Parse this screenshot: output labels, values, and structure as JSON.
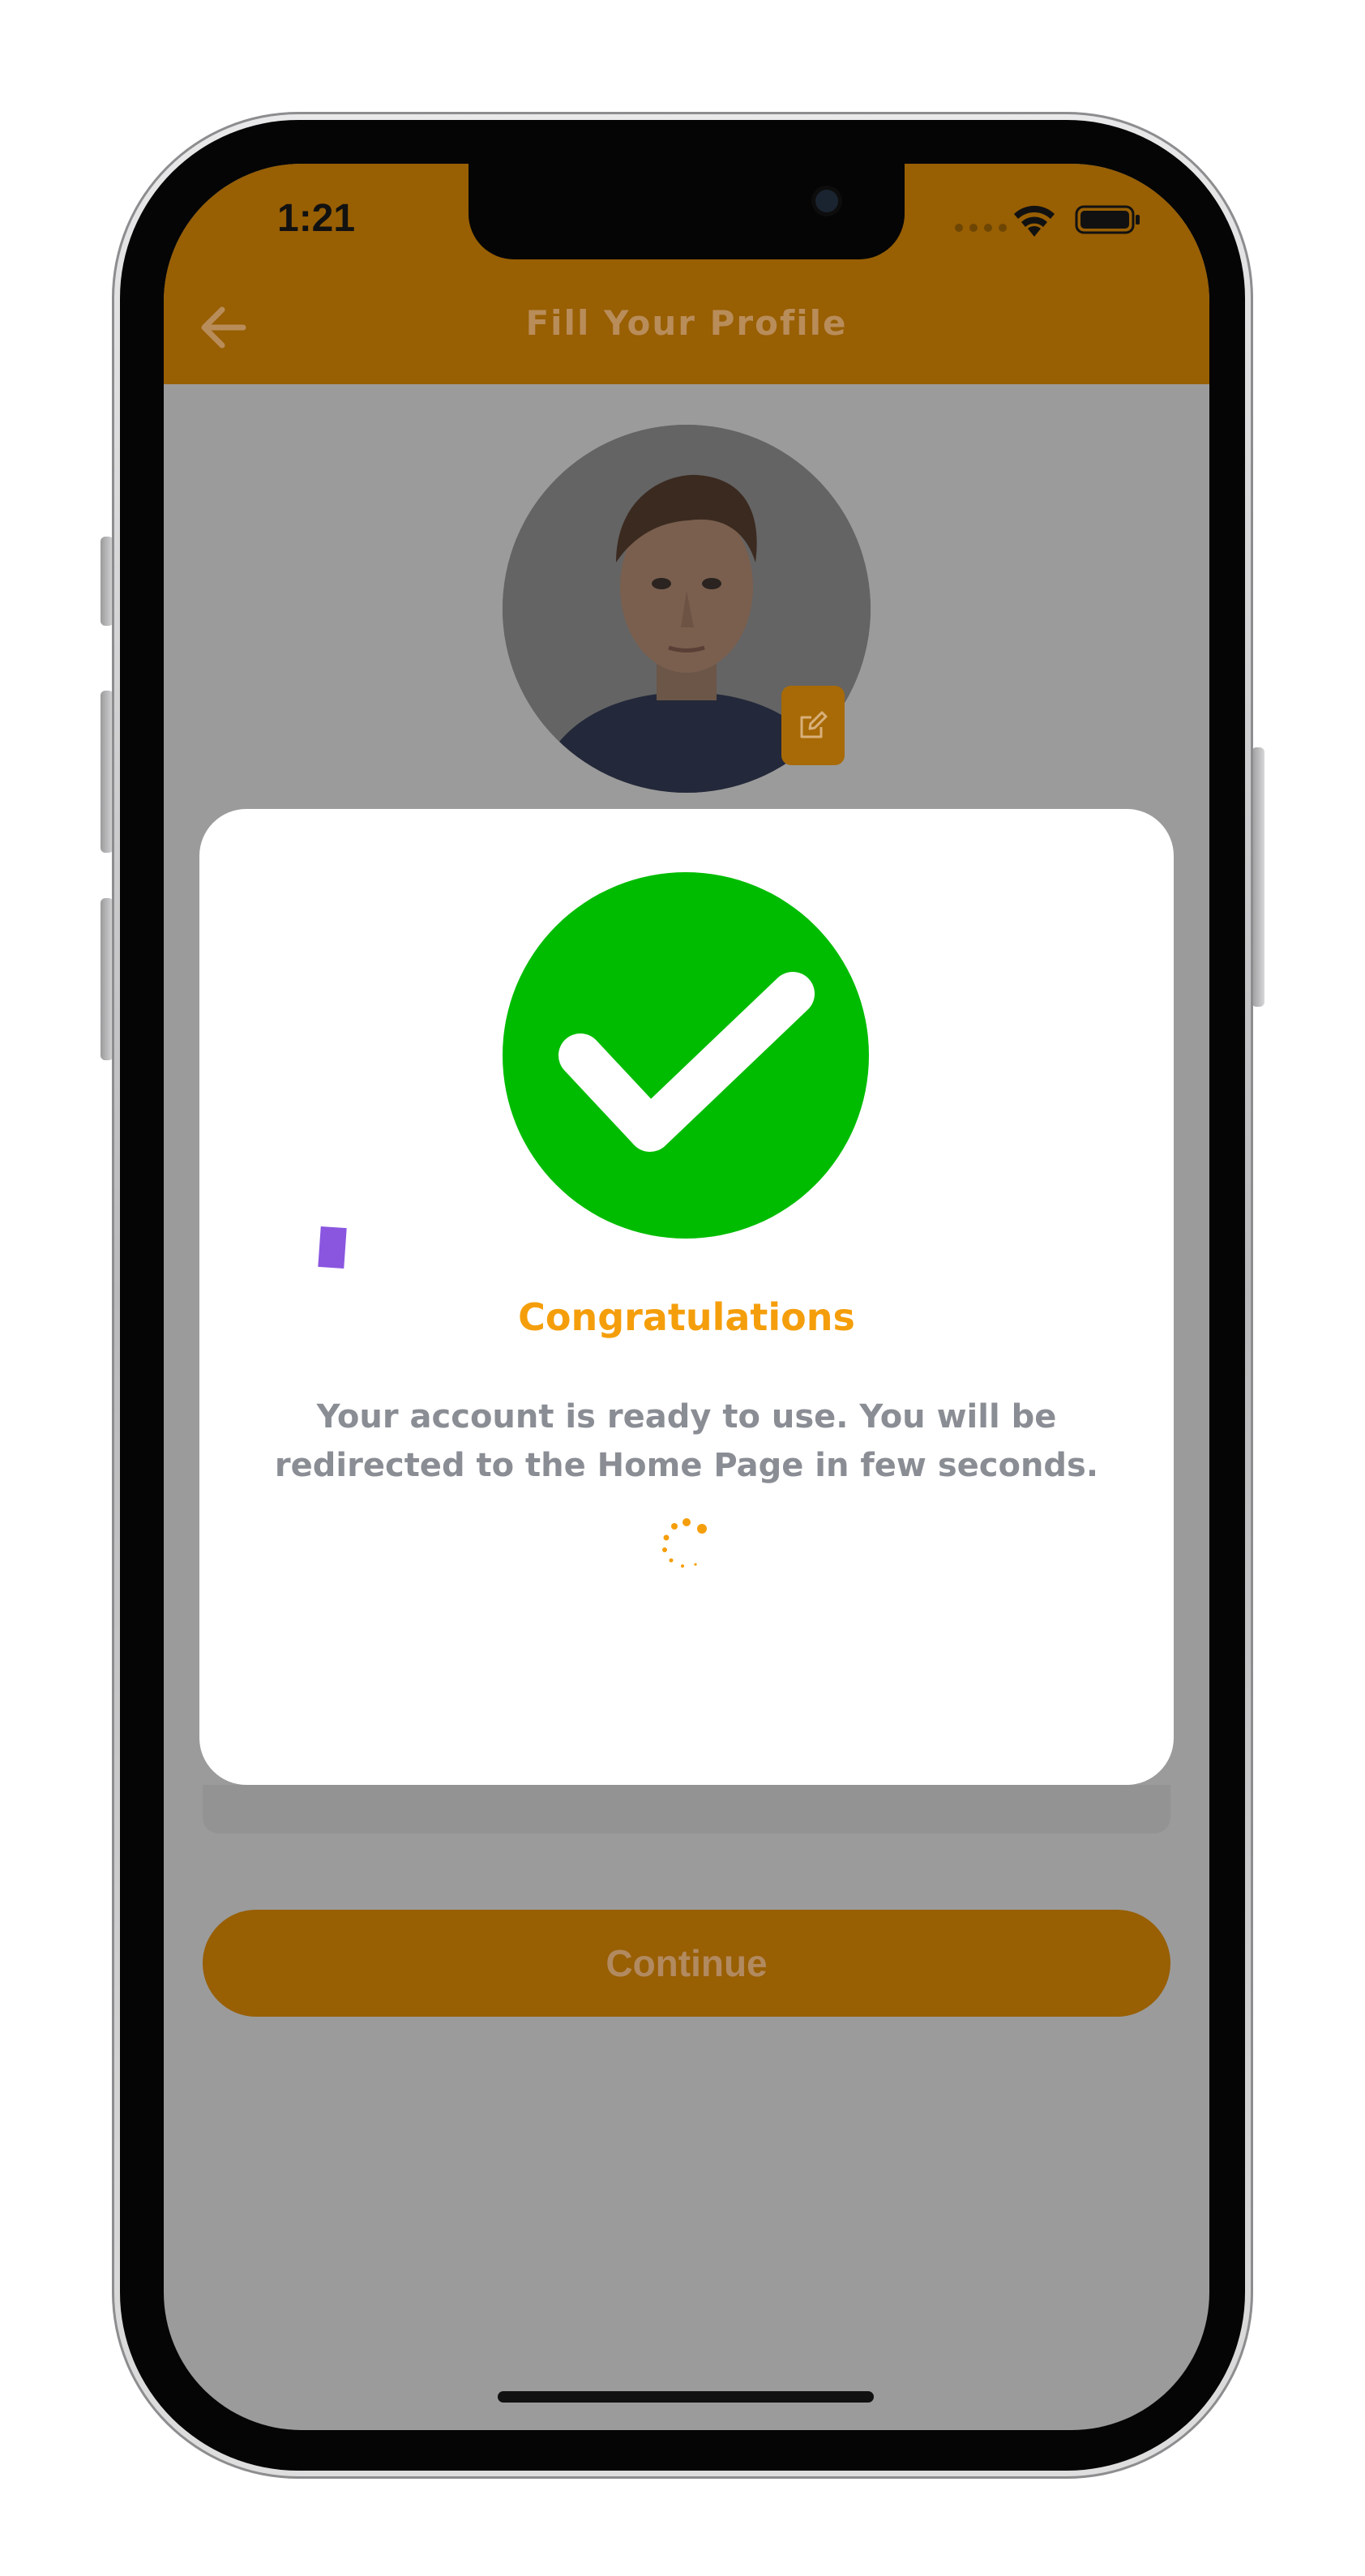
{
  "status_bar": {
    "time": "1:21"
  },
  "header": {
    "title": "Fill Your Profile",
    "back_icon": "arrow-left-icon"
  },
  "profile": {
    "edit_icon": "edit-square-icon"
  },
  "modal": {
    "title": "Congratulations",
    "message": "Your account is ready to use. You will be redirected to the Home Page in few seconds.",
    "icon": "check-circle-icon",
    "loading_icon": "spinner-icon"
  },
  "actions": {
    "continue_label": "Continue"
  },
  "colors": {
    "header_bg": "#985f03",
    "accent": "#f59e0b",
    "success_green": "#00bc00",
    "overlay_gray": "#9b9b9b"
  }
}
